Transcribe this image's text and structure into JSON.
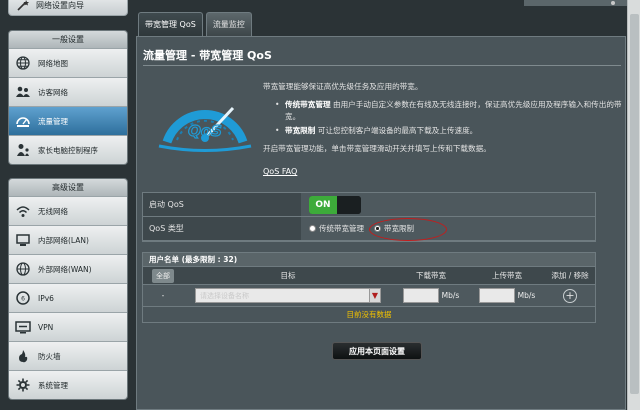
{
  "sidebar": {
    "top_item": "网络设置向导",
    "general": {
      "header": "一般设置",
      "items": [
        {
          "label": "网络地图",
          "icon": "globe-icon"
        },
        {
          "label": "访客网络",
          "icon": "guest-network-icon"
        },
        {
          "label": "流量管理",
          "icon": "traffic-gauge-icon"
        },
        {
          "label": "家长电脑控制程序",
          "icon": "parental-control-icon"
        }
      ]
    },
    "advanced": {
      "header": "高级设置",
      "items": [
        {
          "label": "无线网络",
          "icon": "wifi-icon"
        },
        {
          "label": "内部网络(LAN)",
          "icon": "lan-icon"
        },
        {
          "label": "外部网络(WAN)",
          "icon": "wan-globe-icon"
        },
        {
          "label": "IPv6",
          "icon": "ipv6-icon"
        },
        {
          "label": "VPN",
          "icon": "vpn-icon"
        },
        {
          "label": "防火墙",
          "icon": "firewall-icon"
        },
        {
          "label": "系统管理",
          "icon": "system-admin-icon"
        }
      ]
    }
  },
  "tabs": [
    {
      "label": "带宽管理 QoS",
      "active": true
    },
    {
      "label": "流量监控",
      "active": false
    }
  ],
  "page": {
    "title": "流量管理 - 带宽管理 QoS",
    "intro": "带宽管理能够保证高优先级任务及应用的带宽。",
    "bullet1_bold": "传统带宽管理",
    "bullet1_text": " 由用户手动自定义参数在有线及无线连接时，保证高优先级应用及程序输入和传出的带宽。",
    "bullet2_bold": "带宽限制",
    "bullet2_text": " 可让您控制客户端设备的最高下载及上传速度。",
    "instruction": "开启带宽管理功能，单击带宽管理滑动开关并填写上传和下载数据。",
    "faq_link": "QoS FAQ",
    "gauge_text": "QoS"
  },
  "settings": {
    "enable_label": "启动 QoS",
    "toggle_state": "ON",
    "type_label": "QoS 类型",
    "type_options": [
      "传统带宽管理",
      "带宽限制"
    ],
    "type_selected": "带宽限制"
  },
  "user_list": {
    "title": "用户名单 (最多限制 : 32)",
    "headers": [
      "",
      "目标",
      "下载带宽",
      "上传带宽",
      "添加 / 移除"
    ],
    "all_button": "全部",
    "row_dash": "-",
    "select_placeholder": "请选择设备名称",
    "unit": "Mb/s",
    "empty_message": "目前没有数据"
  },
  "apply_button": "应用本页面设置",
  "colors": {
    "accent_active": "#2e6f9c",
    "toggle_on": "#3dab3a",
    "highlight": "#c21d1d",
    "empty_text": "#f0c000"
  }
}
